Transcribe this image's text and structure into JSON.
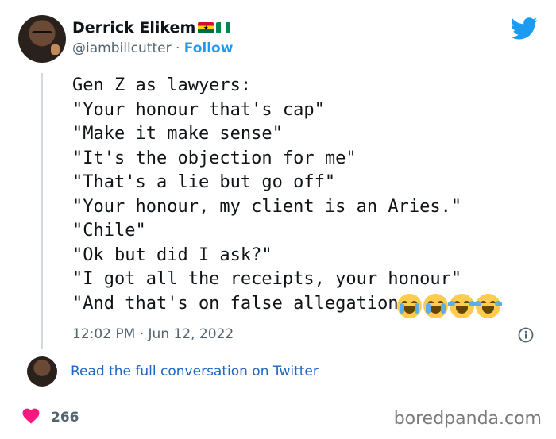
{
  "tweet": {
    "author_name": "Derrick Elikem",
    "handle": "@iambillcutter",
    "separator": " · ",
    "follow_label": "Follow",
    "lines": [
      "Gen Z as lawyers:",
      "\"Your honour that's cap\"",
      "\"Make it make sense\"",
      "\"It's the objection for me\"",
      "\"That's a lie but go off\"",
      "\"Your honour, my client is an Aries.\"",
      "\"Chile\"",
      "\"Ok but did I ask?\"",
      "\"I got all the receipts, your honour\"",
      "\"And that's on false allegations\""
    ],
    "emojis": [
      "loudly-crying-face",
      "loudly-crying-face",
      "face-with-tears-of-joy",
      "face-with-tears-of-joy"
    ],
    "timestamp": "12:02 PM · Jun 12, 2022",
    "read_conversation_label": "Read the full conversation on Twitter",
    "like_count": "266"
  },
  "watermark": "boredpanda.com",
  "colors": {
    "accent": "#1d9bf0",
    "heart": "#f91880",
    "muted": "#536471"
  },
  "flags": [
    "ghana-flag",
    "nigeria-flag"
  ]
}
